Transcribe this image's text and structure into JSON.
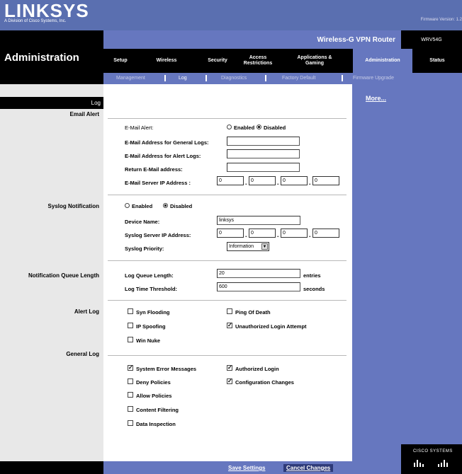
{
  "header": {
    "brand": "LINKSYS",
    "tagline": "A Division of Cisco Systems, Inc.",
    "firmware": "Firmware Version: 1.2",
    "product": "Wireless-G VPN Router",
    "model": "WRV54G"
  },
  "section_title": "Administration",
  "nav": {
    "tabs": [
      {
        "label": "Setup"
      },
      {
        "label": "Wireless"
      },
      {
        "label": "Security"
      },
      {
        "label": "Access Restrictions"
      },
      {
        "label": "Applications & Gaming"
      },
      {
        "label": "Administration"
      },
      {
        "label": "Status"
      }
    ],
    "active_tab": "Administration",
    "subtabs": [
      {
        "label": "Management"
      },
      {
        "label": "Log"
      },
      {
        "label": "Diagnostics"
      },
      {
        "label": "Factory Default"
      },
      {
        "label": "Firmware Upgrade"
      }
    ],
    "active_subtab": "Log"
  },
  "sidebar": {
    "page_label": "Log",
    "sections": {
      "email_alert": "Email Alert",
      "syslog": "Syslog Notification",
      "queue": "Notification Queue Length",
      "alert_log": "Alert Log",
      "general_log": "General Log"
    }
  },
  "help": {
    "more": "More..."
  },
  "radio_labels": {
    "enabled": "Enabled",
    "disabled": "Disabled"
  },
  "email": {
    "alert_label": "E-Mail Alert:",
    "alert_state": "Disabled",
    "general_logs_label": "E-Mail Address for General Logs:",
    "general_logs_value": "",
    "alert_logs_label": "E-Mail Address for Alert Logs:",
    "alert_logs_value": "",
    "return_label": "Return E-Mail address:",
    "return_value": "",
    "server_ip_label": "E-Mail Server IP Address :",
    "server_ip": [
      "0",
      "0",
      "0",
      "0"
    ]
  },
  "syslog": {
    "state": "Disabled",
    "device_name_label": "Device Name:",
    "device_name": "linksys",
    "server_ip_label": "Syslog Server IP Address:",
    "server_ip": [
      "0",
      "0",
      "0",
      "0"
    ],
    "priority_label": "Syslog Priority:",
    "priority": "Information"
  },
  "queue": {
    "length_label": "Log Queue Length:",
    "length": "20",
    "length_unit": "entries",
    "threshold_label": "Log Time Threshold:",
    "threshold": "600",
    "threshold_unit": "seconds"
  },
  "alert_log": {
    "syn_flooding": {
      "label": "Syn Flooding",
      "checked": false
    },
    "ping_of_death": {
      "label": "Ping Of Death",
      "checked": false
    },
    "ip_spoofing": {
      "label": "IP Spoofing",
      "checked": false
    },
    "unauthorized_login": {
      "label": "Unauthorized Login Attempt",
      "checked": true
    },
    "win_nuke": {
      "label": "Win Nuke",
      "checked": false
    }
  },
  "general_log": {
    "system_error": {
      "label": "System Error Messages",
      "checked": true
    },
    "authorized_login": {
      "label": "Authorized Login",
      "checked": true
    },
    "deny_policies": {
      "label": "Deny Policies",
      "checked": false
    },
    "config_changes": {
      "label": "Configuration Changes",
      "checked": true
    },
    "allow_policies": {
      "label": "Allow Policies",
      "checked": false
    },
    "content_filtering": {
      "label": "Content Filtering",
      "checked": false
    },
    "data_inspection": {
      "label": "Data Inspection",
      "checked": false
    }
  },
  "footer": {
    "save": "Save Settings",
    "cancel": "Cancel Changes",
    "cisco": "CISCO SYSTEMS"
  },
  "colors": {
    "brand_blue": "#6677bf",
    "header_blue": "#5a6fb0",
    "black": "#000000",
    "side_gray": "#e8e8e8"
  }
}
